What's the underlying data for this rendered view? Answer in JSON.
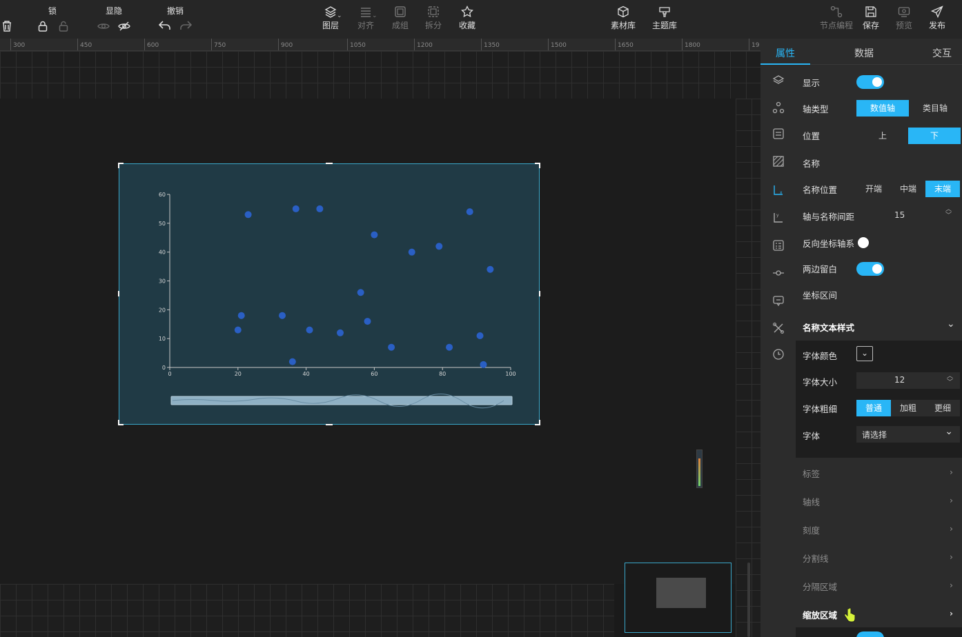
{
  "toolbar": {
    "groups": [
      {
        "label": "锁"
      },
      {
        "label": "显隐"
      },
      {
        "label": "撤销"
      }
    ],
    "buttons": [
      {
        "label": "图层"
      },
      {
        "label": "对齐"
      },
      {
        "label": "成组"
      },
      {
        "label": "拆分"
      },
      {
        "label": "收藏"
      },
      {
        "label": "素材库"
      },
      {
        "label": "主题库"
      },
      {
        "label": "节点编程"
      },
      {
        "label": "保存"
      },
      {
        "label": "预览"
      },
      {
        "label": "发布"
      }
    ]
  },
  "ruler": {
    "ticks": [
      "300",
      "450",
      "600",
      "750",
      "900",
      "1050",
      "1200",
      "1350",
      "1500",
      "1650",
      "1800",
      "19"
    ]
  },
  "panel": {
    "tabs": [
      {
        "label": "属性"
      },
      {
        "label": "数据"
      },
      {
        "label": "交互"
      }
    ],
    "rows": {
      "show": "显示",
      "axis_type": "轴类型",
      "axis_type_options": [
        "数值轴",
        "类目轴"
      ],
      "position": "位置",
      "position_options": [
        "上",
        "下"
      ],
      "name": "名称",
      "name_position": "名称位置",
      "name_position_options": [
        "开端",
        "中端",
        "末端"
      ],
      "name_gap": "轴与名称间距",
      "name_gap_value": "15",
      "reverse": "反向坐标轴系",
      "boundary_gap": "两边留白",
      "axis_range": "坐标区间",
      "name_text_style": "名称文本样式"
    },
    "text_style": {
      "font_color": "字体颜色",
      "font_size": "字体大小",
      "font_size_value": "12",
      "font_weight": "字体粗细",
      "font_weight_options": [
        "普通",
        "加粗",
        "更细"
      ],
      "font_family": "字体",
      "font_family_placeholder": "请选择"
    },
    "sections": [
      {
        "label": "标签"
      },
      {
        "label": "轴线"
      },
      {
        "label": "刻度"
      },
      {
        "label": "分割线"
      },
      {
        "label": "分隔区域"
      },
      {
        "label": "缩放区域"
      }
    ]
  },
  "chart_data": {
    "type": "scatter",
    "xlim": [
      0,
      100
    ],
    "ylim": [
      0,
      60
    ],
    "xticks": [
      "0",
      "20",
      "40",
      "60",
      "80",
      "100"
    ],
    "yticks": [
      "0",
      "10",
      "20",
      "30",
      "40",
      "50",
      "60"
    ],
    "points": [
      [
        20,
        13
      ],
      [
        21,
        18
      ],
      [
        23,
        53
      ],
      [
        33,
        18
      ],
      [
        36,
        2
      ],
      [
        37,
        55
      ],
      [
        41,
        13
      ],
      [
        44,
        55
      ],
      [
        50,
        12
      ],
      [
        56,
        26
      ],
      [
        58,
        16
      ],
      [
        60,
        46
      ],
      [
        65,
        7
      ],
      [
        71,
        40
      ],
      [
        79,
        42
      ],
      [
        82,
        7
      ],
      [
        88,
        54
      ],
      [
        91,
        11
      ],
      [
        92,
        1
      ],
      [
        94,
        34
      ]
    ],
    "point_color": "#2a5fc4"
  },
  "colors": {
    "accent": "#29b6f6",
    "chart_bg": "#203a45"
  }
}
